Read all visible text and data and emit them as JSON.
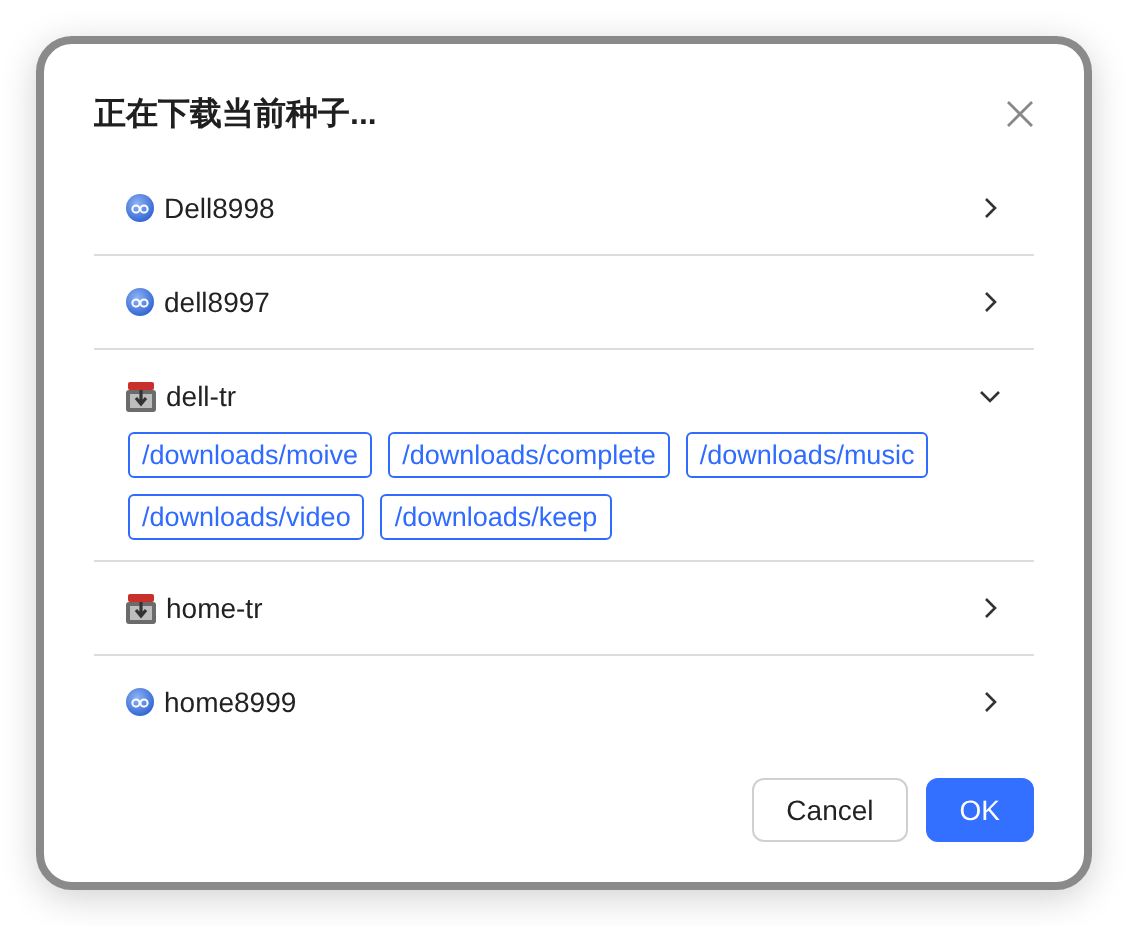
{
  "dialog": {
    "title": "正在下载当前种子...",
    "clients": [
      {
        "name": "Dell8998",
        "kind": "qb",
        "expanded": false
      },
      {
        "name": "dell8997",
        "kind": "qb",
        "expanded": false
      },
      {
        "name": "dell-tr",
        "kind": "tr",
        "expanded": true,
        "paths": [
          "/downloads/moive",
          "/downloads/complete",
          "/downloads/music",
          "/downloads/video",
          "/downloads/keep"
        ]
      },
      {
        "name": "home-tr",
        "kind": "tr",
        "expanded": false
      },
      {
        "name": "home8999",
        "kind": "qb",
        "expanded": false
      }
    ],
    "buttons": [
      {
        "label": "Cancel",
        "kind": "default"
      },
      {
        "label": "OK",
        "kind": "primary"
      }
    ]
  }
}
